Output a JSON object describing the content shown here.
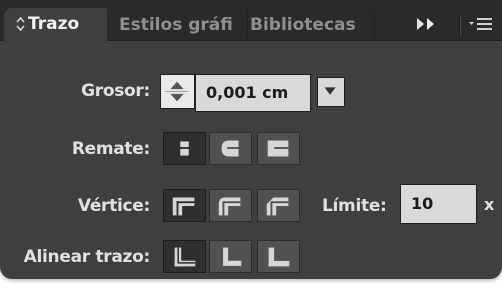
{
  "tabs": [
    {
      "label": "Trazo",
      "active": true
    },
    {
      "label": "Estilos gráfi",
      "active": false
    },
    {
      "label": "Bibliotecas",
      "active": false
    }
  ],
  "toolbar": {
    "more_icon": "double-chevron-right-icon",
    "menu_icon": "panel-menu-icon"
  },
  "grosor": {
    "label": "Grosor:",
    "value": "0,001 cm"
  },
  "remate": {
    "label": "Remate:",
    "options": [
      "butt-cap-icon",
      "round-cap-icon",
      "projecting-cap-icon"
    ],
    "selected": 0
  },
  "vertice": {
    "label": "Vértice:",
    "options": [
      "miter-join-icon",
      "round-join-icon",
      "bevel-join-icon"
    ],
    "selected": 0
  },
  "limite": {
    "label": "Límite:",
    "value": "10",
    "unit": "x"
  },
  "alinear": {
    "label": "Alinear trazo:",
    "options": [
      "align-center-icon",
      "align-inside-icon",
      "align-outside-icon"
    ],
    "selected": 0
  },
  "colors": {
    "panel": "#3f3f3f",
    "tabbar": "#2a2a2a",
    "label": "#e1e1e1",
    "field": "#d9d9d9"
  }
}
